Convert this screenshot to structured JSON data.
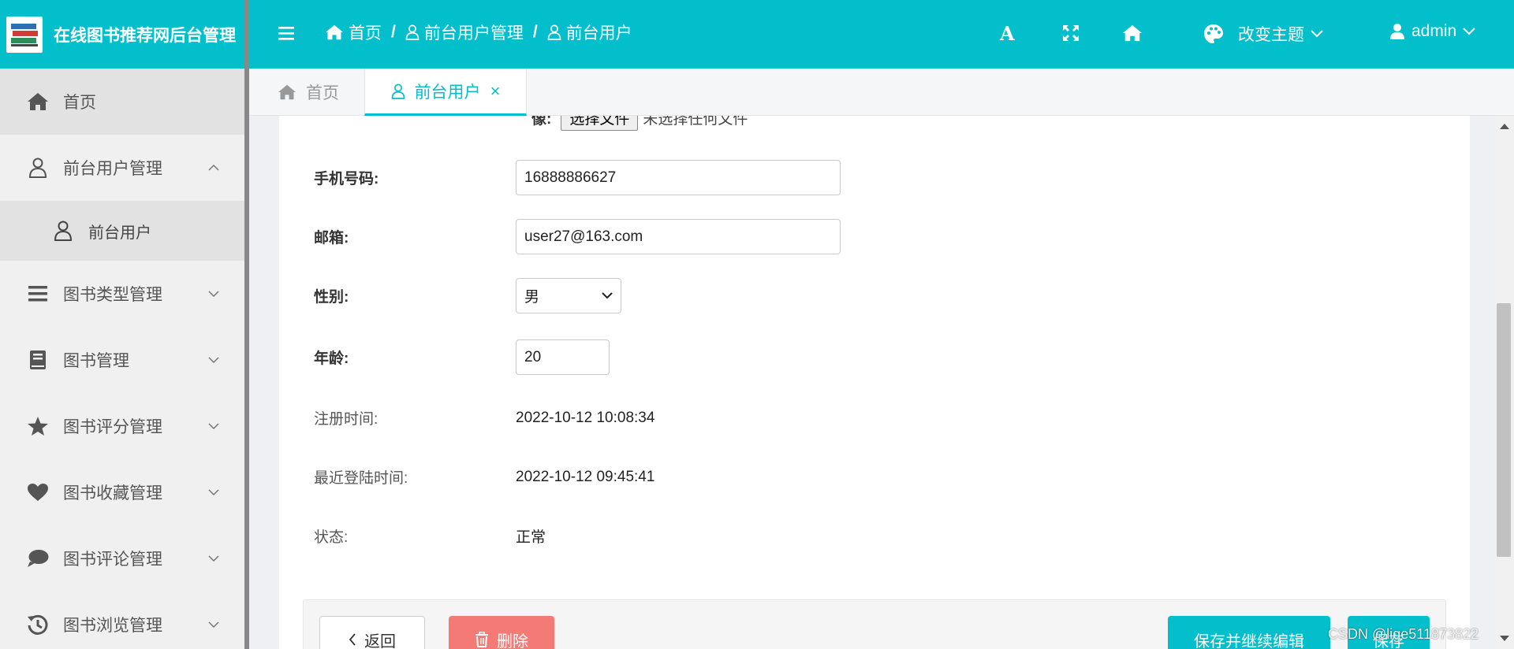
{
  "app": {
    "title": "在线图书推荐网后台管理"
  },
  "sidebar": {
    "items": [
      {
        "label": "首页",
        "icon": "home-icon"
      },
      {
        "label": "前台用户管理",
        "icon": "user-icon"
      },
      {
        "label": "前台用户",
        "icon": "user-icon"
      },
      {
        "label": "图书类型管理",
        "icon": "list-icon"
      },
      {
        "label": "图书管理",
        "icon": "book-icon"
      },
      {
        "label": "图书评分管理",
        "icon": "star-icon"
      },
      {
        "label": "图书收藏管理",
        "icon": "heart-icon"
      },
      {
        "label": "图书评论管理",
        "icon": "comment-icon"
      },
      {
        "label": "图书浏览管理",
        "icon": "history-icon"
      }
    ]
  },
  "topbar": {
    "breadcrumbs": [
      "首页",
      "前台用户管理",
      "前台用户"
    ],
    "breadcrumb_sep": "/",
    "font_glyph": "A",
    "theme_label": "改变主题",
    "user_label": "admin"
  },
  "tabs": [
    {
      "label": "首页"
    },
    {
      "label": "前台用户",
      "close": "×"
    }
  ],
  "form": {
    "file_label_partial": "像:",
    "file_button": "选择文件",
    "file_status": "未选择任何文件",
    "phone": {
      "label": "手机号码:",
      "value": "16888886627"
    },
    "email": {
      "label": "邮箱:",
      "value": "user27@163.com"
    },
    "gender": {
      "label": "性别:",
      "value": "男"
    },
    "age": {
      "label": "年龄:",
      "value": "20"
    },
    "register_time": {
      "label": "注册时间:",
      "value": "2022-10-12 10:08:34"
    },
    "last_login": {
      "label": "最近登陆时间:",
      "value": "2022-10-12 09:45:41"
    },
    "status": {
      "label": "状态:",
      "value": "正常"
    }
  },
  "actions": {
    "back": "返回",
    "delete": "删除",
    "save_continue": "保存并继续编辑",
    "save": "保存"
  },
  "watermark": "CSDN @lige511873822",
  "colors": {
    "accent": "#03bfcb",
    "danger": "#f47a75",
    "sidebar_bg": "#f0f0f0"
  }
}
